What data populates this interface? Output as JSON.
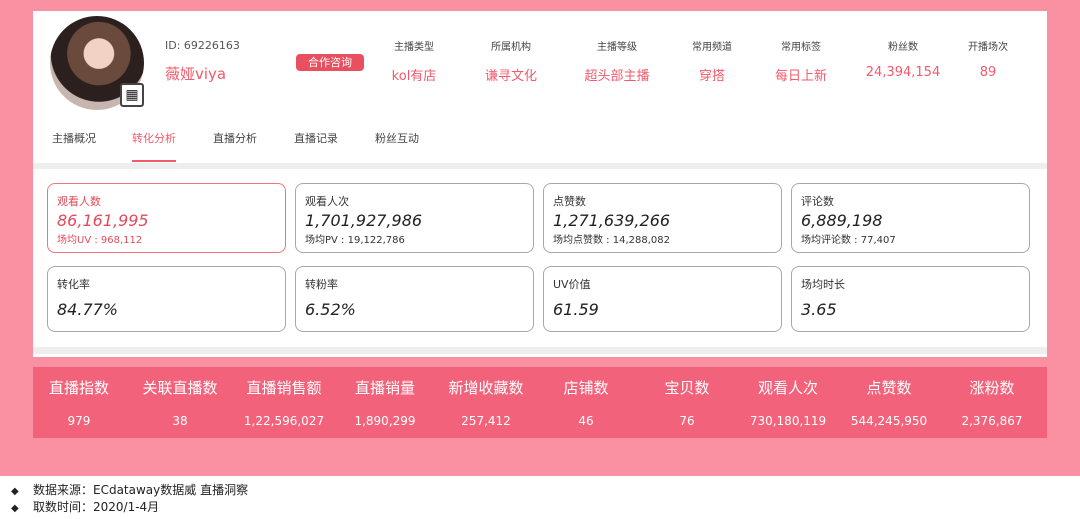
{
  "profile": {
    "id_text": "ID: 69226163",
    "name": "薇娅viya",
    "consult_label": "合作咨询",
    "meta": [
      {
        "label": "主播类型",
        "value": "kol有店"
      },
      {
        "label": "所属机构",
        "value": "谦寻文化"
      },
      {
        "label": "主播等级",
        "value": "超头部主播"
      },
      {
        "label": "常用频道",
        "value": "穿搭"
      },
      {
        "label": "常用标签",
        "value": "每日上新"
      },
      {
        "label": "粉丝数",
        "value": "24,394,154"
      },
      {
        "label": "开播场次",
        "value": "89"
      }
    ]
  },
  "tabs": [
    "主播概况",
    "转化分析",
    "直播分析",
    "直播记录",
    "粉丝互动"
  ],
  "active_tab": "转化分析",
  "stats_row1": [
    {
      "label": "观看人数",
      "value": "86,161,995",
      "sub": "场均UV : 968,112",
      "active": true
    },
    {
      "label": "观看人次",
      "value": "1,701,927,986",
      "sub": "场均PV : 19,122,786"
    },
    {
      "label": "点赞数",
      "value": "1,271,639,266",
      "sub": "场均点赞数 : 14,288,082"
    },
    {
      "label": "评论数",
      "value": "6,889,198",
      "sub": "场均评论数 : 77,407"
    }
  ],
  "stats_row2": [
    {
      "label": "转化率",
      "value": "84.77%"
    },
    {
      "label": "转粉率",
      "value": "6.52%"
    },
    {
      "label": "UV价值",
      "value": "61.59"
    },
    {
      "label": "场均时长",
      "value": "3.65"
    }
  ],
  "summary": {
    "headers": [
      "直播指数",
      "关联直播数",
      "直播销售额",
      "直播销量",
      "新增收藏数",
      "店铺数",
      "宝贝数",
      "观看人次",
      "点赞数",
      "涨粉数"
    ],
    "values": [
      "979",
      "38",
      "1,22,596,027",
      "1,890,299",
      "257,412",
      "46",
      "76",
      "730,180,119",
      "544,245,950",
      "2,376,867"
    ]
  },
  "notes": {
    "bullet": "◆",
    "source": "数据来源：ECdataway数据威 直播洞察",
    "time": "取数时间：2020/1-4月"
  },
  "colors": {
    "accent": "#f15b6c",
    "page_bg": "#fa91a2",
    "summary_bg": "#f2637b"
  }
}
